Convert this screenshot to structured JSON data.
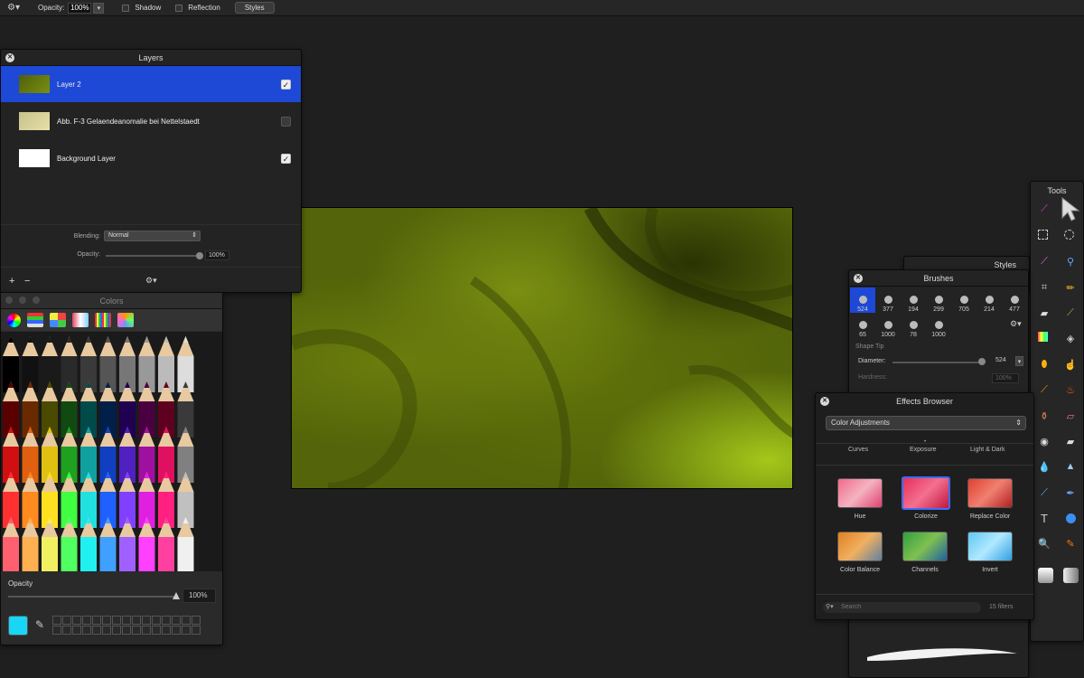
{
  "toolbar": {
    "opacity_label": "Opacity:",
    "opacity_value": "100%",
    "shadow_label": "Shadow",
    "reflection_label": "Reflection",
    "styles_label": "Styles"
  },
  "layers": {
    "title": "Layers",
    "items": [
      {
        "name": "Layer 2",
        "visible": true,
        "selected": true
      },
      {
        "name": "Abb. F-3 Gelaendeanomalie bei Nettelstaedt",
        "visible": false,
        "selected": false
      },
      {
        "name": "Background Layer",
        "visible": true,
        "selected": false
      }
    ],
    "blending_label": "Blending:",
    "blending_value": "Normal",
    "opacity_label": "Opacity:",
    "opacity_value": "100%",
    "opacity_level": 1.0,
    "add_label": "+",
    "remove_label": "−"
  },
  "colors": {
    "title": "Colors",
    "opacity_label": "Opacity",
    "opacity_value": "100%",
    "opacity_level": 1.0,
    "current_color": "#19d6f5"
  },
  "tools": {
    "title": "Tools"
  },
  "styles": {
    "title": "Styles"
  },
  "brushes": {
    "title": "Brushes",
    "sizes_row1": [
      "524",
      "377",
      "194",
      "299",
      "705",
      "214",
      "477"
    ],
    "sizes_row2": [
      "65",
      "1000",
      "78",
      "1000"
    ],
    "shape_tip_label": "Shape Tip",
    "diameter_label": "Diameter:",
    "diameter_value": "524",
    "hardness_label": "Hardness:",
    "hardness_value": "100%"
  },
  "effects": {
    "title": "Effects Browser",
    "category": "Color Adjustments",
    "tabs": [
      "Curves",
      "Exposure",
      "Light & Dark"
    ],
    "items": [
      {
        "label": "Hue",
        "selected": false
      },
      {
        "label": "Colorize",
        "selected": true
      },
      {
        "label": "Replace Color",
        "selected": false
      },
      {
        "label": "Color Balance",
        "selected": false
      },
      {
        "label": "Channels",
        "selected": false
      },
      {
        "label": "Invert",
        "selected": false
      }
    ],
    "search_placeholder": "Search",
    "count": "15 filters"
  }
}
